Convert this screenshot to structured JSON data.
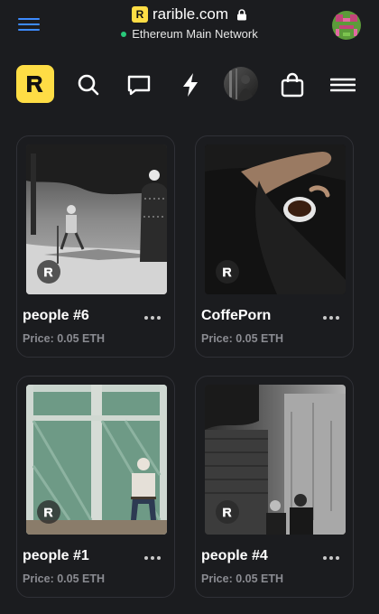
{
  "browser": {
    "domain": "rarible.com",
    "network": "Ethereum Main Network"
  },
  "app": {
    "logo_letter": "R",
    "accent_color": "#fedd45",
    "nav_icons": [
      "search-icon",
      "chat-icon",
      "lightning-icon",
      "profile-avatar",
      "shopping-bag-icon",
      "hamburger-menu-icon"
    ]
  },
  "items": [
    {
      "title": "people #6",
      "price": "Price: 0.05 ETH",
      "badge": "R"
    },
    {
      "title": "CoffePorn",
      "price": "Price: 0.05 ETH",
      "badge": "R"
    },
    {
      "title": "people #1",
      "price": "Price: 0.05 ETH",
      "badge": "R"
    },
    {
      "title": "people #4",
      "price": "Price: 0.05 ETH",
      "badge": "R"
    }
  ]
}
